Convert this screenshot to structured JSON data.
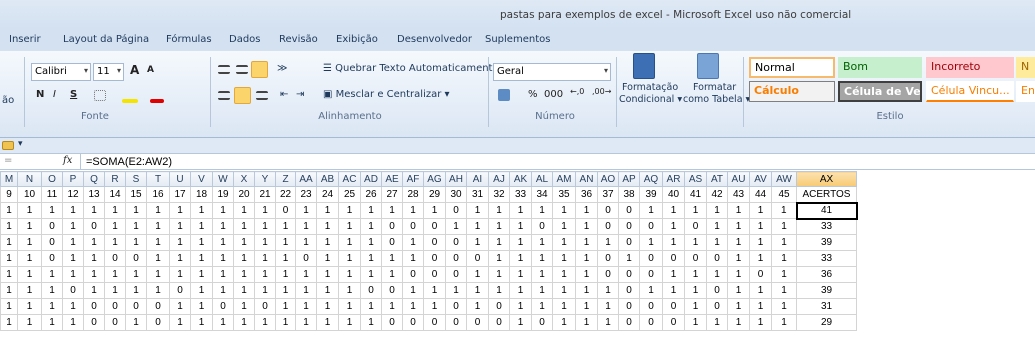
{
  "window": {
    "title": "pastas para exemplos de excel  -  Microsoft Excel uso não comercial"
  },
  "tabs": [
    "Inserir",
    "Layout da Página",
    "Fórmulas",
    "Dados",
    "Revisão",
    "Exibição",
    "Desenvolvedor",
    "Suplementos"
  ],
  "ribbon": {
    "left_cut": "ão",
    "font": {
      "name": "Calibri",
      "size": "11",
      "group": "Fonte",
      "grow": "A",
      "shrink": "A",
      "bold": "N",
      "italic": "I",
      "underline": "S"
    },
    "align": {
      "wrap": "Quebrar Texto Automaticamente",
      "merge": "Mesclar e Centralizar",
      "group": "Alinhamento"
    },
    "number": {
      "format": "Geral",
      "percent": "%",
      "thousands": "000",
      "group": "Número"
    },
    "styles": {
      "cond1": "Formatação",
      "cond2": "Condicional",
      "table1": "Formatar",
      "table2": "como Tabela",
      "group": "Estilo",
      "normal": "Normal",
      "bom": "Bom",
      "incorreto": "Incorreto",
      "n": "N",
      "calculo": "Cálculo",
      "celula_ve": "Célula de Ve...",
      "celula_vinc": "Célula Vincu...",
      "en": "En"
    }
  },
  "formula_bar": {
    "fx": "fx",
    "formula": "=SOMA(E2:AW2)"
  },
  "colors": {
    "accent": "#f8ca72",
    "header_bg": "#e4ebf4",
    "ribbon_bg": "#dbe6f4"
  },
  "sheet": {
    "columns": [
      "M",
      "N",
      "O",
      "P",
      "Q",
      "R",
      "S",
      "T",
      "U",
      "V",
      "W",
      "X",
      "Y",
      "Z",
      "AA",
      "AB",
      "AC",
      "AD",
      "AE",
      "AF",
      "AG",
      "AH",
      "AI",
      "AJ",
      "AK",
      "AL",
      "AM",
      "AN",
      "AO",
      "AP",
      "AQ",
      "AR",
      "AS",
      "AT",
      "AU",
      "AV",
      "AW",
      "AX"
    ],
    "rows": [
      [
        "9",
        "10",
        "11",
        "12",
        "13",
        "14",
        "15",
        "16",
        "17",
        "18",
        "19",
        "20",
        "21",
        "22",
        "23",
        "24",
        "25",
        "26",
        "27",
        "28",
        "29",
        "30",
        "31",
        "32",
        "33",
        "34",
        "35",
        "36",
        "37",
        "38",
        "39",
        "40",
        "41",
        "42",
        "43",
        "44",
        "45",
        "ACERTOS"
      ],
      [
        "1",
        "1",
        "1",
        "1",
        "1",
        "1",
        "1",
        "1",
        "1",
        "1",
        "1",
        "1",
        "1",
        "0",
        "1",
        "1",
        "1",
        "1",
        "1",
        "1",
        "1",
        "0",
        "1",
        "1",
        "1",
        "1",
        "1",
        "1",
        "0",
        "0",
        "1",
        "1",
        "1",
        "1",
        "1",
        "1",
        "1",
        "41"
      ],
      [
        "1",
        "1",
        "0",
        "1",
        "0",
        "1",
        "1",
        "1",
        "1",
        "1",
        "1",
        "1",
        "1",
        "1",
        "1",
        "1",
        "1",
        "1",
        "0",
        "0",
        "0",
        "1",
        "1",
        "1",
        "1",
        "0",
        "1",
        "1",
        "0",
        "0",
        "0",
        "1",
        "0",
        "1",
        "1",
        "1",
        "1",
        "33"
      ],
      [
        "1",
        "1",
        "0",
        "1",
        "1",
        "1",
        "1",
        "1",
        "1",
        "1",
        "1",
        "1",
        "1",
        "1",
        "1",
        "1",
        "1",
        "1",
        "0",
        "1",
        "0",
        "0",
        "1",
        "1",
        "1",
        "1",
        "1",
        "1",
        "1",
        "0",
        "1",
        "1",
        "1",
        "1",
        "1",
        "1",
        "1",
        "39"
      ],
      [
        "1",
        "1",
        "0",
        "1",
        "1",
        "0",
        "0",
        "1",
        "1",
        "1",
        "1",
        "1",
        "1",
        "1",
        "0",
        "1",
        "1",
        "1",
        "1",
        "1",
        "0",
        "0",
        "0",
        "1",
        "1",
        "1",
        "1",
        "1",
        "0",
        "1",
        "0",
        "0",
        "0",
        "0",
        "1",
        "1",
        "1",
        "33"
      ],
      [
        "1",
        "1",
        "1",
        "1",
        "1",
        "1",
        "1",
        "1",
        "1",
        "1",
        "1",
        "1",
        "1",
        "1",
        "1",
        "1",
        "1",
        "1",
        "1",
        "0",
        "0",
        "0",
        "1",
        "1",
        "1",
        "1",
        "1",
        "1",
        "0",
        "0",
        "0",
        "1",
        "1",
        "1",
        "1",
        "0",
        "1",
        "36"
      ],
      [
        "1",
        "1",
        "1",
        "0",
        "1",
        "1",
        "1",
        "1",
        "0",
        "1",
        "1",
        "1",
        "1",
        "1",
        "1",
        "1",
        "1",
        "0",
        "0",
        "1",
        "1",
        "1",
        "1",
        "1",
        "1",
        "1",
        "1",
        "1",
        "1",
        "0",
        "1",
        "1",
        "1",
        "0",
        "1",
        "1",
        "1",
        "39"
      ],
      [
        "1",
        "1",
        "1",
        "1",
        "0",
        "0",
        "0",
        "0",
        "1",
        "1",
        "0",
        "1",
        "0",
        "1",
        "1",
        "1",
        "1",
        "1",
        "1",
        "1",
        "1",
        "0",
        "1",
        "0",
        "1",
        "1",
        "1",
        "1",
        "1",
        "0",
        "0",
        "0",
        "1",
        "0",
        "1",
        "1",
        "1",
        "31"
      ],
      [
        "1",
        "1",
        "1",
        "1",
        "0",
        "0",
        "1",
        "0",
        "1",
        "1",
        "1",
        "1",
        "1",
        "1",
        "1",
        "1",
        "1",
        "1",
        "0",
        "0",
        "0",
        "0",
        "0",
        "0",
        "1",
        "0",
        "1",
        "1",
        "1",
        "0",
        "0",
        "0",
        "1",
        "1",
        "1",
        "1",
        "1",
        "29"
      ]
    ]
  }
}
